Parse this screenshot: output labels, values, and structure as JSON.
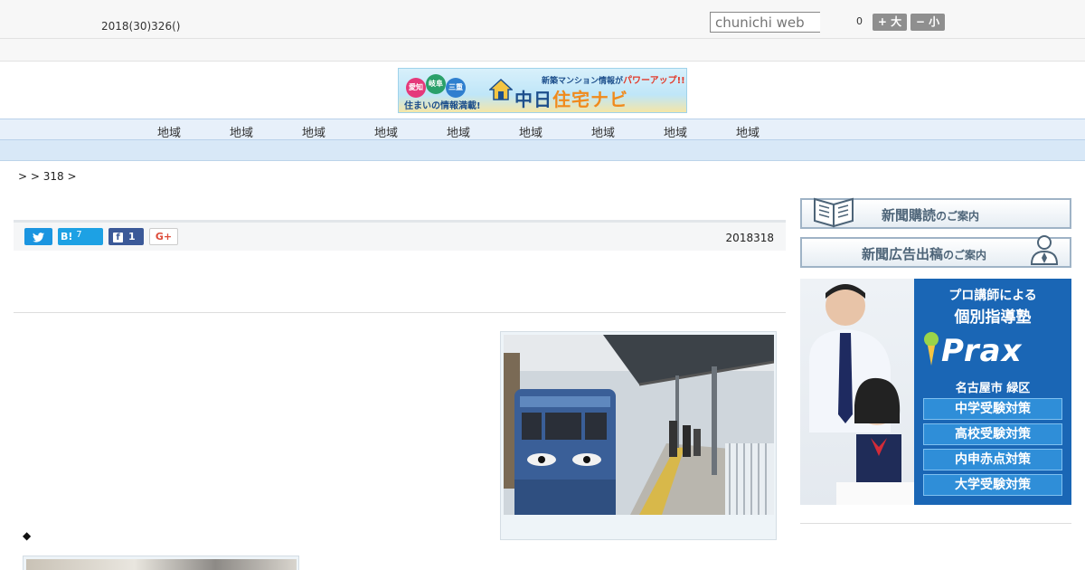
{
  "header": {
    "date_text": "2018(30)326()",
    "search_placeholder": "chunichi web",
    "font_size_counter": "0",
    "font_larger_label": "+ 大",
    "font_smaller_label": "− 小"
  },
  "banner": {
    "badge_aichi": "愛知",
    "badge_gifu": "岐阜",
    "badge_mie": "三重",
    "tagline": "住まいの情報満載!",
    "top_text": "新築マンション情報が",
    "top_emphasis": "パワーアップ!!",
    "brand_part1": "中日",
    "brand_part2": "住宅ナビ"
  },
  "nav": {
    "items": [
      {
        "label": "地域"
      },
      {
        "label": "地域"
      },
      {
        "label": "地域"
      },
      {
        "label": "地域"
      },
      {
        "label": "地域"
      },
      {
        "label": "地域"
      },
      {
        "label": "地域"
      },
      {
        "label": "地域"
      },
      {
        "label": "地域"
      }
    ]
  },
  "breadcrumb": {
    "text": ">  > 318 >"
  },
  "share": {
    "hatena_label": "B!",
    "hatena_count": "7",
    "facebook_count": "1",
    "gplus_label": "G+",
    "article_date": "2018318"
  },
  "article": {
    "bullet": "◆"
  },
  "sidebar": {
    "subscribe_main": "新聞購読",
    "subscribe_sub": "のご案内",
    "ad_main": "新聞広告出稿",
    "ad_sub": "のご案内"
  },
  "ad": {
    "headline1": "プロ講師による",
    "headline2": "個別指導塾",
    "logo": "Prax",
    "city": "名古屋市 緑区",
    "pills": [
      "中学受験対策",
      "高校受験対策",
      "内申赤点対策",
      "大学受験対策"
    ]
  },
  "colors": {
    "nav_bg": "#e7f0fa",
    "twitter": "#1b95e0",
    "hatena": "#1da1e4",
    "facebook": "#3b5998",
    "ad_blue": "#1a66b5"
  }
}
